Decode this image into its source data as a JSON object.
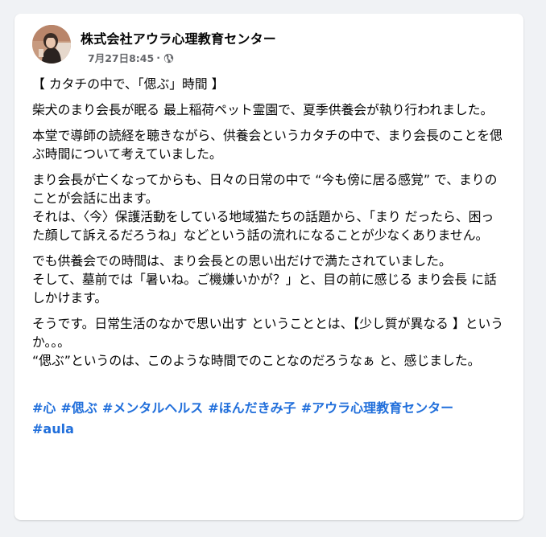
{
  "post": {
    "author": "株式会社アウラ心理教育センター",
    "timestamp": "7月27日8:45",
    "separator": "·",
    "privacy_icon": "globe-icon",
    "paragraphs": [
      "【 カタチの中で、「偲ぶ」時間 】",
      "柴犬のまり会長が眠る 最上稲荷ペット霊園で、夏季供養会が執り行われました。",
      "本堂で導師の読経を聴きながら、供養会というカタチの中で、まり会長のことを偲ぶ時間について考えていました。",
      "まり会長が亡くなってからも、日々の日常の中で “今も傍に居る感覚” で、まりのことが会話に出ます。\nそれは、〈今〉保護活動をしている地域猫たちの話題から、「まり だったら、困った顔して訴えるだろうね」などという話の流れになることが少なくありません。",
      "でも供養会での時間は、まり会長との思い出だけで満たされていました。\nそして、墓前では「暑いね。ご機嫌いかが？」と、目の前に感じる まり会長 に話しかけます。",
      "そうです。日常生活のなかで思い出す ということとは、【少し質が異なる 】というか。。。\n“偲ぶ”というのは、このような時間でのことなのだろうなぁ と、感じました。"
    ],
    "hashtags": [
      "#心",
      "#偲ぶ",
      "#メンタルヘルス",
      "#ほんだきみ子",
      "#アウラ心理教育センター",
      "#aula"
    ],
    "colors": {
      "background": "#f0f2f5",
      "card": "#ffffff",
      "text": "#050505",
      "meta": "#65676b",
      "hashtag": "#216fdb"
    }
  }
}
